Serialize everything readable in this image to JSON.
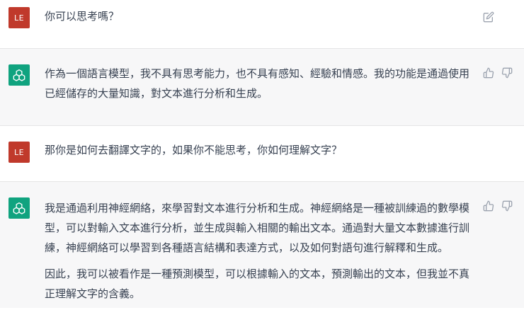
{
  "conversation": {
    "user_avatar_label": "LE",
    "messages": [
      {
        "role": "user",
        "text": "你可以思考嗎？"
      },
      {
        "role": "assistant",
        "paragraphs": [
          "作為一個語言模型，我不具有思考能力，也不具有感知、經驗和情感。我的功能是通過使用已經儲存的大量知識，對文本進行分析和生成。"
        ]
      },
      {
        "role": "user",
        "text": "那你是如何去翻譯文字的，如果你不能思考，你如何理解文字？"
      },
      {
        "role": "assistant",
        "paragraphs": [
          "我是通過利用神經網絡，來學習對文本進行分析和生成。神經網絡是一種被訓練過的數學模型，可以對輸入文本進行分析，並生成與輸入相關的輸出文本。通過對大量文本數據進行訓練，神經網絡可以學習到各種語言結構和表達方式，以及如何對語句進行解釋和生成。",
          "因此，我可以被看作是一種預測模型，可以根據輸入的文本，預測輸出的文本，但我並不真正理解文字的含義。"
        ]
      }
    ]
  },
  "icons": {
    "edit": "edit-icon",
    "thumbs_up": "thumbs-up-icon",
    "thumbs_down": "thumbs-down-icon",
    "assistant_logo": "openai-logo-icon"
  },
  "colors": {
    "user_avatar": "#c0392b",
    "assistant_avatar": "#10a37f",
    "assistant_row_bg": "#f7f7f8",
    "text": "#374151"
  }
}
